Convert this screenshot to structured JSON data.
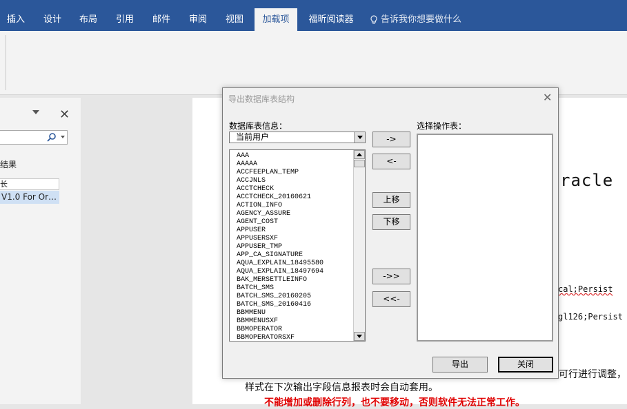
{
  "ribbon": {
    "tabs": [
      "插入",
      "设计",
      "布局",
      "引用",
      "邮件",
      "审阅",
      "视图",
      "加载项",
      "福昕阅读器"
    ],
    "active_tab": "加载项",
    "tell_me": "告诉我你想要做什么"
  },
  "nav": {
    "results_label": "结果",
    "heading_1": "长",
    "heading_2": "V1.0 For Or…"
  },
  "document": {
    "title_fragment": "racle",
    "persist_1": "cal;Persist",
    "persist_2": "gl126;Persist",
    "adjust_fragment": "可行进行调整，",
    "style_line": "样式在下次输出字段信息报表时会自动套用。",
    "warning_line": "不能增加或删除行列，也不要移动，否则软件无法正常工作。"
  },
  "dialog": {
    "title": "导出数据库表结构",
    "db_info_label": "数据库表信息：",
    "select_label": "选择操作表：",
    "combo_value": "当前用户",
    "tables": [
      "AAA",
      "AAAAA",
      "ACCFEEPLAN_TEMP",
      "ACCJNLS",
      "ACCTCHECK",
      "ACCTCHECK_20160621",
      "ACTION_INFO",
      "AGENCY_ASSURE",
      "AGENT_COST",
      "APPUSER",
      "APPUSERSXF",
      "APPUSER_TMP",
      "APP_CA_SIGNATURE",
      "AQUA_EXPLAIN_18495580",
      "AQUA_EXPLAIN_18497694",
      "BAK_MERSETTLEINFO",
      "BATCH_SMS",
      "BATCH_SMS_20160205",
      "BATCH_SMS_20160416",
      "BBMMENU",
      "BBMMENUSXF",
      "BBMOPERATOR",
      "BBMOPERATORSXF"
    ],
    "buttons": {
      "add": "->",
      "remove": "<-",
      "up": "上移",
      "down": "下移",
      "add_all": "->>",
      "remove_all": "<<-",
      "export": "导出",
      "close": "关闭"
    }
  }
}
